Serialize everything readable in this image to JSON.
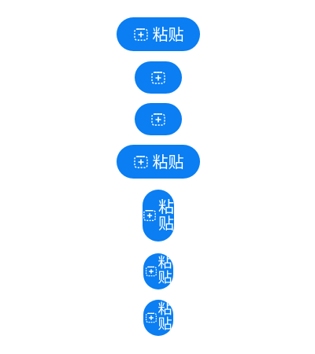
{
  "theme": {
    "accent": "#0a7ef2",
    "text": "#ffffff"
  },
  "buttons": [
    {
      "icon": "paste-icon",
      "label": "粘贴"
    },
    {
      "icon": "paste-icon",
      "label": ""
    },
    {
      "icon": "paste-icon",
      "label": ""
    },
    {
      "icon": "paste-icon",
      "label": "粘贴"
    },
    {
      "icon": "paste-icon",
      "label": "粘贴"
    },
    {
      "icon": "paste-icon",
      "label": "粘贴"
    },
    {
      "icon": "paste-icon",
      "label": "粘贴"
    }
  ]
}
